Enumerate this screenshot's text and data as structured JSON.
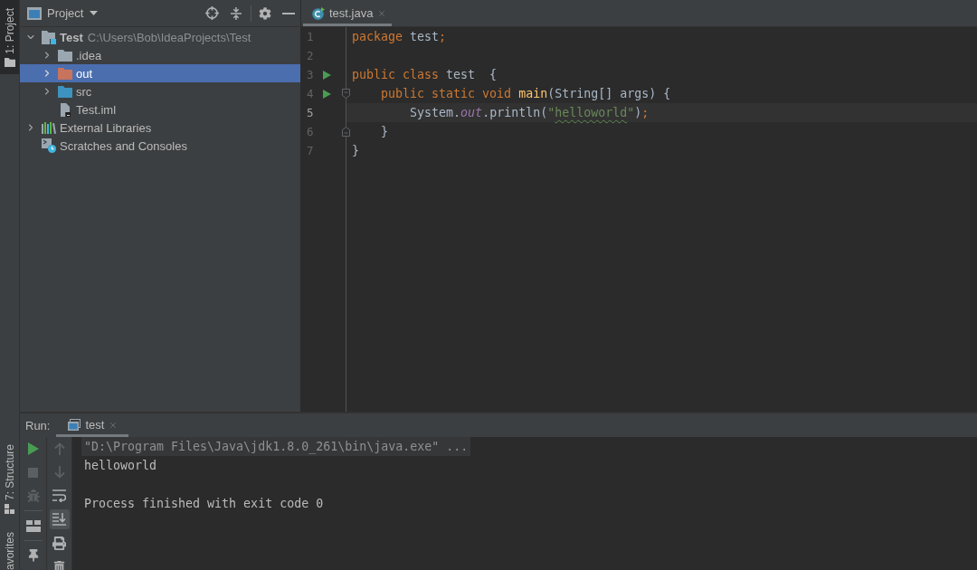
{
  "tool_stripe": {
    "top_tabs": [
      {
        "label": "1: Project",
        "kind": "project",
        "selected": true
      }
    ],
    "bottom_tabs": [
      {
        "label": "7: Structure",
        "kind": "structure",
        "selected": false
      },
      {
        "label": "avorites",
        "kind": "favorites",
        "selected": false
      }
    ]
  },
  "project_panel": {
    "title": "Project",
    "tree": [
      {
        "label": "Test",
        "path": "C:\\Users\\Bob\\IdeaProjects\\Test",
        "kind": "module",
        "expanded": true,
        "selected": false,
        "children": [
          {
            "label": ".idea",
            "kind": "folder",
            "expanded": false,
            "selected": false
          },
          {
            "label": "out",
            "kind": "excluded_folder",
            "expanded": false,
            "selected": true
          },
          {
            "label": "src",
            "kind": "source_folder",
            "expanded": false,
            "selected": false
          },
          {
            "label": "Test.iml",
            "kind": "file",
            "selected": false
          }
        ]
      },
      {
        "label": "External Libraries",
        "kind": "libraries",
        "expanded": false,
        "selected": false
      },
      {
        "label": "Scratches and Consoles",
        "kind": "scratches",
        "selected": false
      }
    ]
  },
  "editor": {
    "tabs": [
      {
        "label": "test.java",
        "selected": true
      }
    ],
    "lines": [
      {
        "number": "1",
        "current": false,
        "run_marker": false,
        "fold_start": false,
        "fold_end": false,
        "tokens": [
          {
            "text": "package",
            "kind": "keyword"
          },
          {
            "text": " test",
            "kind": "plain"
          },
          {
            "text": ";",
            "kind": "semicolon"
          }
        ]
      },
      {
        "number": "2",
        "current": false,
        "run_marker": false,
        "fold_start": false,
        "fold_end": false
      },
      {
        "number": "3",
        "current": false,
        "run_marker": true,
        "fold_start": false,
        "fold_end": false,
        "tokens": [
          {
            "text": "public class",
            "kind": "keyword"
          },
          {
            "text": " test  {",
            "kind": "plain"
          }
        ]
      },
      {
        "number": "4",
        "current": false,
        "run_marker": true,
        "fold_start": true,
        "fold_end": false,
        "tokens": [
          {
            "text": "    public static void",
            "kind": "keyword"
          },
          {
            "text": " main",
            "kind": "method"
          },
          {
            "text": "(String[] args) {",
            "kind": "plain"
          }
        ]
      },
      {
        "number": "5",
        "current": true,
        "run_marker": false,
        "fold_start": false,
        "fold_end": false,
        "tokens": [
          {
            "text": "        System.",
            "kind": "plain"
          },
          {
            "text": "out",
            "kind": "field"
          },
          {
            "text": ".println(",
            "kind": "plain"
          },
          {
            "text": "\"",
            "kind": "string"
          },
          {
            "text": "helloworld",
            "kind": "typo_string"
          },
          {
            "text": "\"",
            "kind": "string"
          },
          {
            "text": ")",
            "kind": "plain"
          },
          {
            "text": ";",
            "kind": "semicolon"
          }
        ]
      },
      {
        "number": "6",
        "current": false,
        "run_marker": false,
        "fold_start": false,
        "fold_end": true,
        "tokens": [
          {
            "text": "    }",
            "kind": "plain"
          }
        ]
      },
      {
        "number": "7",
        "current": false,
        "run_marker": false,
        "fold_start": false,
        "fold_end": false,
        "tokens": [
          {
            "text": "}",
            "kind": "plain"
          }
        ]
      }
    ]
  },
  "run_panel": {
    "label": "Run:",
    "tabs": [
      {
        "label": "test",
        "selected": true
      }
    ],
    "toolbar_left": [
      {
        "kind": "run",
        "disabled": false,
        "on": false
      },
      {
        "kind": "stop",
        "disabled": true,
        "on": false
      },
      {
        "kind": "debug",
        "disabled": true,
        "on": false
      },
      {
        "kind": "layout",
        "disabled": false,
        "on": false
      },
      {
        "kind": "pin",
        "disabled": false,
        "on": false
      }
    ],
    "toolbar_right": [
      {
        "kind": "up",
        "disabled": true,
        "on": false
      },
      {
        "kind": "down",
        "disabled": true,
        "on": false
      },
      {
        "kind": "wrap",
        "disabled": false,
        "on": false
      },
      {
        "kind": "scroll_end",
        "disabled": false,
        "on": true
      },
      {
        "kind": "print",
        "disabled": false,
        "on": false
      },
      {
        "kind": "trash",
        "disabled": false,
        "on": false
      }
    ],
    "console": [
      {
        "text": "\"D:\\Program Files\\Java\\jdk1.8.0_261\\bin\\java.exe\" ...",
        "kind": "command"
      },
      {
        "text": "helloworld",
        "kind": "output"
      },
      {
        "text": "Process finished with exit code 0",
        "kind": "exit"
      }
    ]
  }
}
